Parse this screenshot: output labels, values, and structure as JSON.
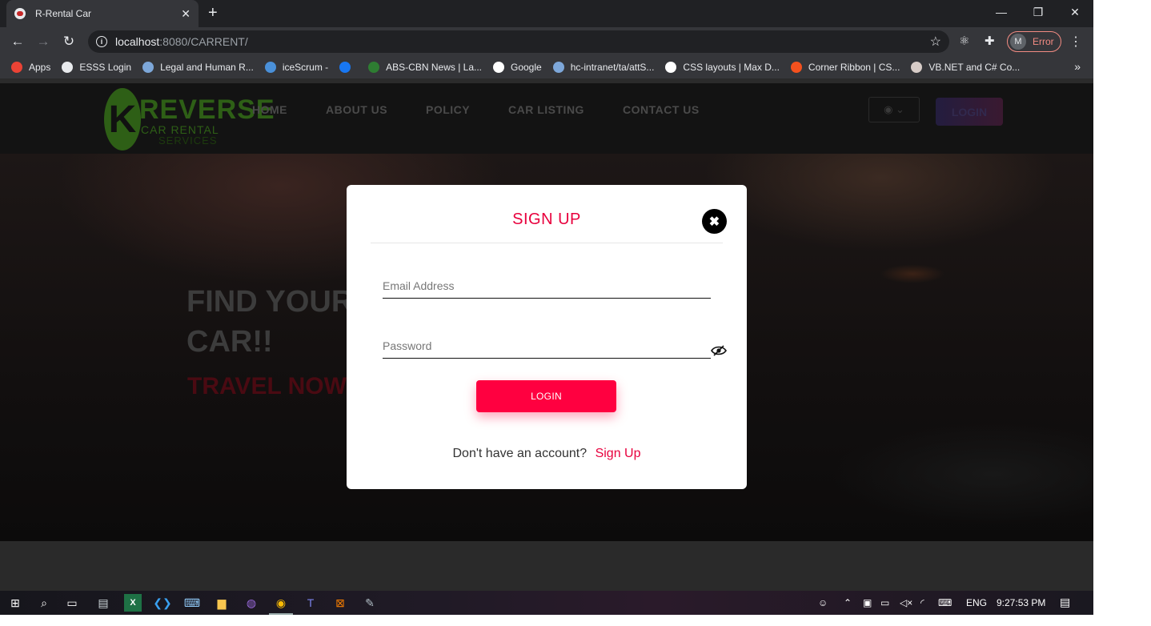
{
  "browser": {
    "tab_title": "R-Rental Car",
    "tab_close": "✕",
    "new_tab": "+",
    "url_host": "localhost",
    "url_path": ":8080/CARRENT/",
    "profile_initial": "M",
    "profile_status": "Error",
    "window_controls": [
      "—",
      "❐",
      "✕"
    ]
  },
  "bookmarks": [
    {
      "label": "Apps",
      "icon": "apps-grid-icon",
      "color": "#ea4335"
    },
    {
      "label": "ESSS Login",
      "icon": "globe-icon",
      "color": "#e8eaed"
    },
    {
      "label": "Legal and Human R...",
      "icon": "seal-icon",
      "color": "#7da7d9"
    },
    {
      "label": "iceScrum -",
      "icon": "icescrum-icon",
      "color": "#4a90d9"
    },
    {
      "label": "",
      "icon": "facebook-icon",
      "color": "#1877f2"
    },
    {
      "label": "ABS-CBN News | La...",
      "icon": "abscbn-icon",
      "color": "#2e7d32"
    },
    {
      "label": "Google",
      "icon": "google-icon",
      "color": "#ffffff"
    },
    {
      "label": "hc-intranet/ta/attS...",
      "icon": "intranet-icon",
      "color": "#7da7d9"
    },
    {
      "label": "CSS layouts | Max D...",
      "icon": "css-layouts-icon",
      "color": "#ffffff"
    },
    {
      "label": "Corner Ribbon | CS...",
      "icon": "codepen-icon",
      "color": "#f4511e"
    },
    {
      "label": "VB.NET and C# Co...",
      "icon": "vbnet-icon",
      "color": "#d7ccc8"
    }
  ],
  "site": {
    "logo_letter": "K",
    "logo_word": "REVERSE",
    "logo_sub": "CAR RENTAL",
    "logo_sub2": "SERVICES",
    "nav": [
      "HOME",
      "ABOUT US",
      "POLICY",
      "CAR LISTING",
      "CONTACT US"
    ],
    "user_menu_icon": "user-circle-icon",
    "login_label": "LOGIN",
    "hero_line1": "FIND YOUR",
    "hero_line2": "CAR!!",
    "hero_tagline": "TRAVEL NOW"
  },
  "modal": {
    "title": "SIGN UP",
    "close_icon": "close-icon",
    "email_placeholder": "Email Address",
    "password_placeholder": "Password",
    "login_button": "LOGIN",
    "prompt": "Don't have an account?",
    "signup_link": "Sign Up"
  },
  "taskbar": {
    "language": "ENG",
    "time": "9:27:53 PM"
  }
}
